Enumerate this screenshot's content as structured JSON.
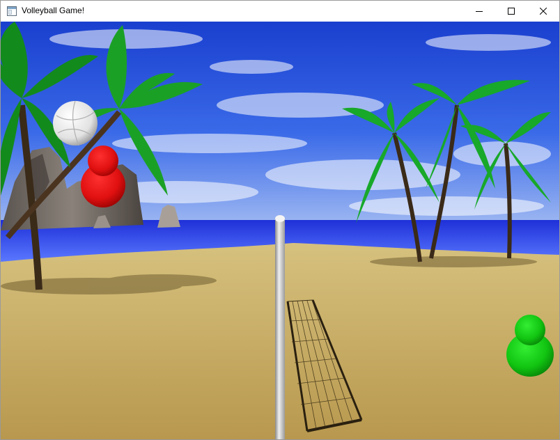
{
  "window": {
    "title": "Volleyball Game!",
    "app_icon": "application-window-icon",
    "controls": {
      "minimize_icon": "minimize-icon",
      "maximize_icon": "maximize-icon",
      "close_icon": "close-icon"
    }
  },
  "scene": {
    "sky_color": "#1f4fd9",
    "sea_color": "#2a44e0",
    "sand_color": "#c4a862",
    "ball_color": "#f2f2f2",
    "left_player_color": "#e01010",
    "right_player_color": "#11c411",
    "pole_color": "#cfcfcf"
  }
}
